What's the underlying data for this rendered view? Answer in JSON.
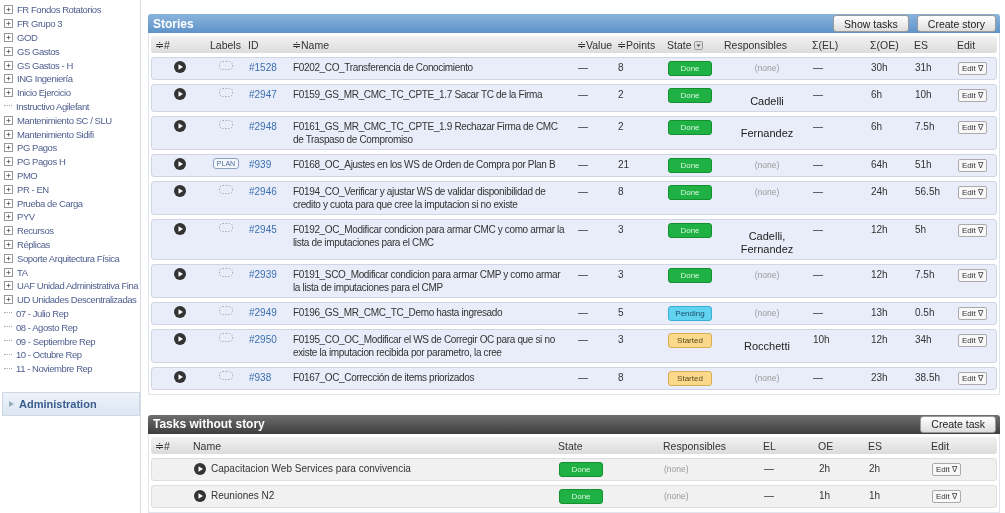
{
  "sidebar": {
    "tree": [
      {
        "label": "FR Fondos Rotatorios",
        "kind": "folder"
      },
      {
        "label": "FR Grupo 3",
        "kind": "folder"
      },
      {
        "label": "GOD",
        "kind": "folder"
      },
      {
        "label": "GS Gastos",
        "kind": "folder"
      },
      {
        "label": "GS Gastos - H",
        "kind": "folder"
      },
      {
        "label": "ING Ingeniería",
        "kind": "folder"
      },
      {
        "label": "Inicio Ejercicio",
        "kind": "folder"
      },
      {
        "label": "Instructivo Agilefant",
        "kind": "leaf"
      },
      {
        "label": "Mantenimiento SC / SLU",
        "kind": "folder"
      },
      {
        "label": "Mantenimiento Sidifi",
        "kind": "folder"
      },
      {
        "label": "PG Pagos",
        "kind": "folder"
      },
      {
        "label": "PG Pagos H",
        "kind": "folder"
      },
      {
        "label": "PMO",
        "kind": "folder"
      },
      {
        "label": "PR - EN",
        "kind": "folder"
      },
      {
        "label": "Prueba de Carga",
        "kind": "folder"
      },
      {
        "label": "PYV",
        "kind": "folder"
      },
      {
        "label": "Recursos",
        "kind": "folder"
      },
      {
        "label": "Réplicas",
        "kind": "folder"
      },
      {
        "label": "Soporte Arquitectura Física",
        "kind": "folder"
      },
      {
        "label": "TA",
        "kind": "folder"
      },
      {
        "label": "UAF Unidad Administrativa Fina",
        "kind": "folder"
      },
      {
        "label": "UD Unidades Descentralizadas",
        "kind": "folder"
      },
      {
        "label": "07 - Julio Rep",
        "kind": "leaf"
      },
      {
        "label": "08 - Agosto Rep",
        "kind": "leaf"
      },
      {
        "label": "09 - Septiembre Rep",
        "kind": "leaf"
      },
      {
        "label": "10 - Octubre Rep",
        "kind": "leaf"
      },
      {
        "label": "11 - Noviembre Rep",
        "kind": "leaf"
      }
    ],
    "administration": "Administration"
  },
  "stories": {
    "title": "Stories",
    "buttons": [
      "Show tasks",
      "Create story"
    ],
    "columns": [
      "≑#",
      "Labels",
      "ID",
      "≑Name",
      "≑Value",
      "≑Points",
      "State",
      "Responsibles",
      "Σ(EL)",
      "Σ(OE)",
      "ES",
      "Edit"
    ],
    "rows": [
      {
        "id": "#1528",
        "name": "F0202_CO_Transferencia de Conocimiento",
        "value": "—",
        "points": "8",
        "state": {
          "text": "Done",
          "kind": "done"
        },
        "responsibles": "(none)",
        "unassigned": true,
        "el": "—",
        "oe": "30h",
        "es": "31h",
        "edit": "Edit ∇"
      },
      {
        "id": "#2947",
        "name": "F0159_GS_MR_CMC_TC_CPTE_1.7 Sacar TC de la Firma",
        "value": "—",
        "points": "2",
        "state": {
          "text": "Done",
          "kind": "done"
        },
        "responsibles": "Cadelli",
        "unassigned": false,
        "el": "—",
        "oe": "6h",
        "es": "10h",
        "edit": "Edit ∇"
      },
      {
        "id": "#2948",
        "name": "F0161_GS_MR_CMC_TC_CPTE_1.9 Rechazar Firma de CMC de Traspaso de Compromiso",
        "value": "—",
        "points": "2",
        "state": {
          "text": "Done",
          "kind": "done"
        },
        "responsibles": "Fernandez",
        "unassigned": false,
        "el": "—",
        "oe": "6h",
        "es": "7.5h",
        "edit": "Edit ∇"
      },
      {
        "label": "PLAN",
        "id": "#939",
        "name": "F0168_OC_Ajustes en los WS de Orden de Compra por Plan B",
        "value": "—",
        "points": "21",
        "state": {
          "text": "Done",
          "kind": "done"
        },
        "responsibles": "(none)",
        "unassigned": true,
        "el": "—",
        "oe": "64h",
        "es": "51h",
        "edit": "Edit ∇"
      },
      {
        "id": "#2946",
        "name": "F0194_CO_Verificar y ajustar WS de validar disponibilidad de credito y cuota para que cree la imputacion si no existe",
        "value": "—",
        "points": "8",
        "state": {
          "text": "Done",
          "kind": "done"
        },
        "responsibles": "(none)",
        "unassigned": true,
        "el": "—",
        "oe": "24h",
        "es": "56.5h",
        "edit": "Edit ∇"
      },
      {
        "id": "#2945",
        "name": "F0192_OC_Modificar condicion para armar CMC y como armar la lista de imputaciones para el CMC",
        "value": "—",
        "points": "3",
        "state": {
          "text": "Done",
          "kind": "done"
        },
        "responsibles": "Cadelli, Fernandez",
        "unassigned": false,
        "el": "—",
        "oe": "12h",
        "es": "5h",
        "edit": "Edit ∇"
      },
      {
        "id": "#2939",
        "name": "F0191_SCO_Modificar condicion para armar CMP y como armar la lista de imputaciones para el CMP",
        "value": "—",
        "points": "3",
        "state": {
          "text": "Done",
          "kind": "done"
        },
        "responsibles": "(none)",
        "unassigned": true,
        "el": "—",
        "oe": "12h",
        "es": "7.5h",
        "edit": "Edit ∇"
      },
      {
        "id": "#2949",
        "name": "F0196_GS_MR_CMC_TC_Demo hasta ingresado",
        "value": "—",
        "points": "5",
        "state": {
          "text": "Pending",
          "kind": "pending"
        },
        "responsibles": "(none)",
        "unassigned": true,
        "el": "—",
        "oe": "13h",
        "es": "0.5h",
        "edit": "Edit ∇"
      },
      {
        "id": "#2950",
        "name": "F0195_CO_OC_Modificar el WS de Corregir OC para que si no existe la imputacion recibida por parametro, la cree",
        "value": "—",
        "points": "3",
        "state": {
          "text": "Started",
          "kind": "started"
        },
        "responsibles": "Rocchetti",
        "unassigned": false,
        "el": "10h",
        "oe": "12h",
        "es": "34h",
        "edit": "Edit ∇"
      },
      {
        "id": "#938",
        "name": "F0167_OC_Corrección de items priorizados",
        "value": "—",
        "points": "8",
        "state": {
          "text": "Started",
          "kind": "started"
        },
        "responsibles": "(none)",
        "unassigned": true,
        "el": "—",
        "oe": "23h",
        "es": "38.5h",
        "edit": "Edit ∇"
      }
    ]
  },
  "tasks": {
    "title": "Tasks without story",
    "button": "Create task",
    "columns": [
      "≑#",
      "Name",
      "State",
      "Responsibles",
      "EL",
      "OE",
      "ES",
      "Edit"
    ],
    "rows": [
      {
        "name": "Capacitacion Web Services para convivencia",
        "state": {
          "text": "Done",
          "kind": "done"
        },
        "responsibles": "(none)",
        "el": "—",
        "oe": "2h",
        "es": "2h",
        "edit": "Edit ∇"
      },
      {
        "name": "Reuniones N2",
        "state": {
          "text": "Done",
          "kind": "done"
        },
        "responsibles": "(none)",
        "el": "—",
        "oe": "1h",
        "es": "1h",
        "edit": "Edit ∇"
      }
    ]
  }
}
